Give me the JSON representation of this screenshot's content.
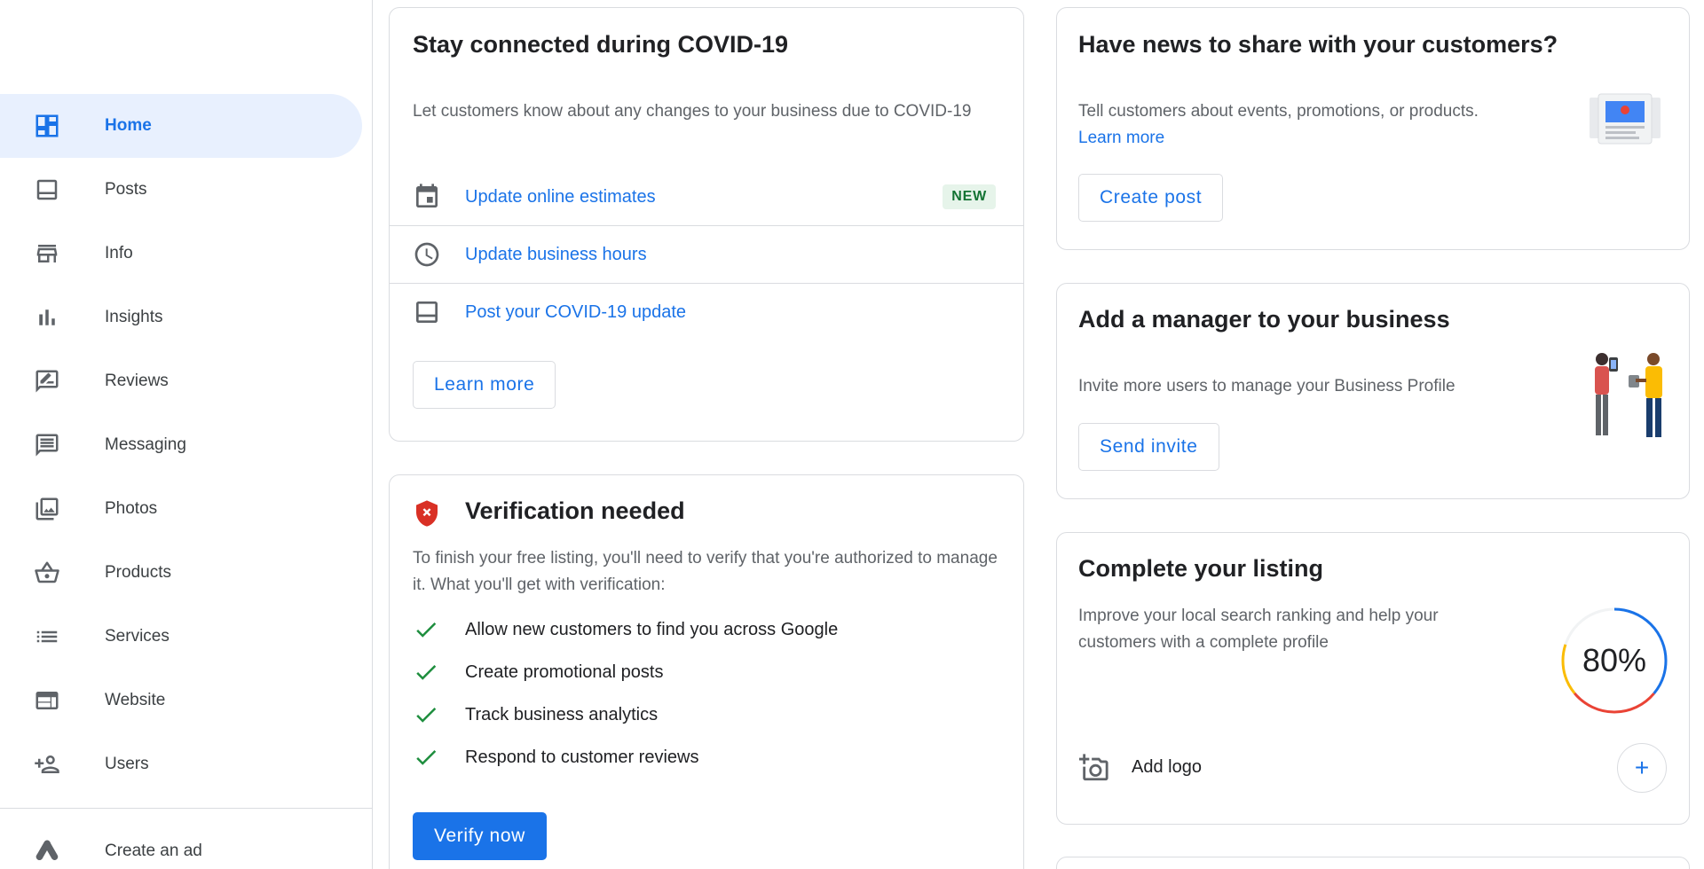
{
  "sidebar": {
    "items": [
      {
        "label": "Home",
        "icon": "dashboard-icon",
        "active": true
      },
      {
        "label": "Posts",
        "icon": "posts-icon"
      },
      {
        "label": "Info",
        "icon": "storefront-icon"
      },
      {
        "label": "Insights",
        "icon": "bar-chart-icon"
      },
      {
        "label": "Reviews",
        "icon": "rate-review-icon"
      },
      {
        "label": "Messaging",
        "icon": "message-icon"
      },
      {
        "label": "Photos",
        "icon": "photo-library-icon"
      },
      {
        "label": "Products",
        "icon": "shopping-basket-icon"
      },
      {
        "label": "Services",
        "icon": "list-icon"
      },
      {
        "label": "Website",
        "icon": "web-icon"
      },
      {
        "label": "Users",
        "icon": "person-add-icon"
      }
    ],
    "create_ad": {
      "label": "Create an ad",
      "icon": "google-ads-icon"
    }
  },
  "covid_card": {
    "title": "Stay connected during COVID-19",
    "description": "Let customers know about any changes to your business due to COVID-19",
    "rows": [
      {
        "label": "Update online estimates",
        "icon": "event-icon",
        "badge": "NEW"
      },
      {
        "label": "Update business hours",
        "icon": "clock-icon"
      },
      {
        "label": "Post your COVID-19 update",
        "icon": "posts-icon"
      }
    ],
    "button": "Learn more"
  },
  "verification_card": {
    "title": "Verification needed",
    "description": "To finish your free listing, you'll need to verify that you're authorized to manage it. What you'll get with verification:",
    "benefits": [
      "Allow new customers to find you across Google",
      "Create promotional posts",
      "Track business analytics",
      "Respond to customer reviews"
    ],
    "button": "Verify now"
  },
  "news_card": {
    "title": "Have news to share with your customers?",
    "description": "Tell customers about events, promotions, or products.",
    "link": "Learn more",
    "button": "Create post"
  },
  "manager_card": {
    "title": "Add a manager to your business",
    "description": "Invite more users to manage your Business Profile",
    "button": "Send invite"
  },
  "listing_card": {
    "title": "Complete your listing",
    "description": "Improve your local search ranking and help your customers with a complete profile",
    "progress": "80%",
    "progress_fraction": 0.8,
    "task": "Add logo"
  },
  "colors": {
    "accent": "#1a73e8",
    "active_bg": "#e8f0fe",
    "success": "#1e8e3e",
    "error": "#d93025"
  }
}
